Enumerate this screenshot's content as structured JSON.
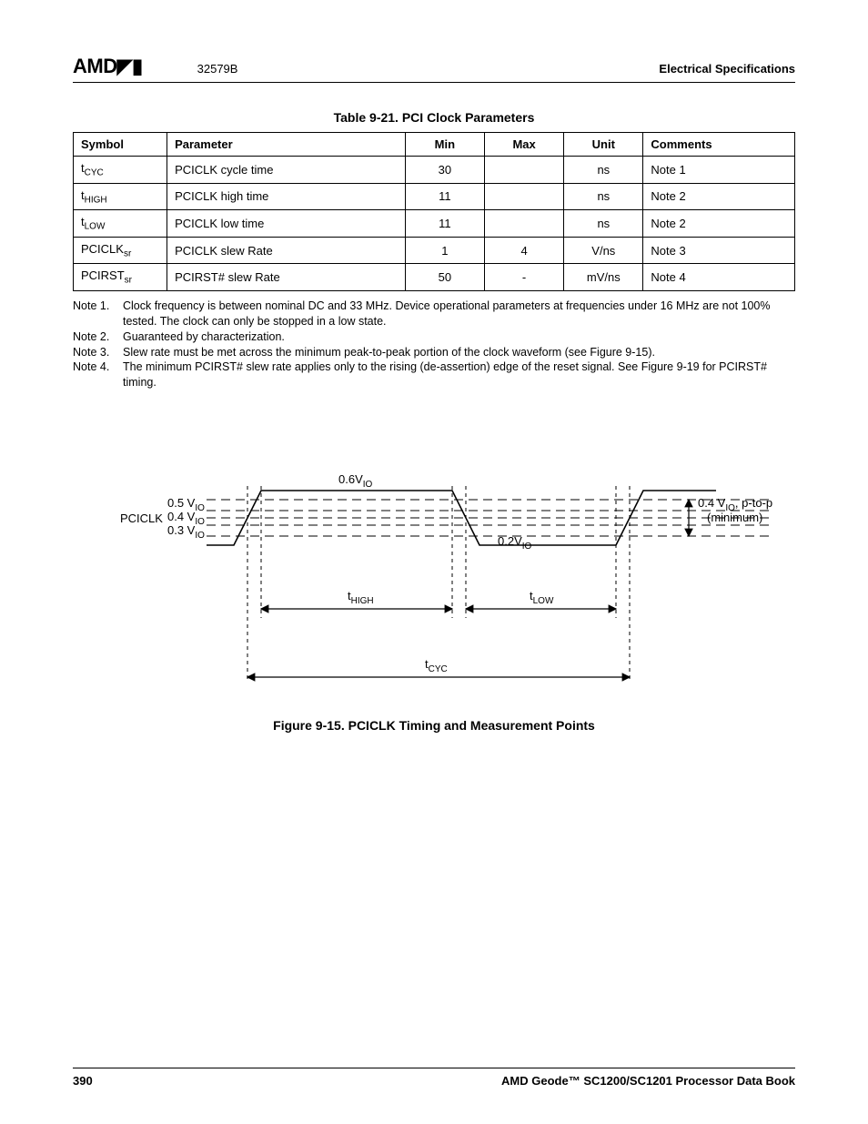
{
  "header": {
    "logo_text": "AMD",
    "doc_number": "32579B",
    "section": "Electrical Specifications"
  },
  "table": {
    "caption": "Table 9-21.  PCI Clock Parameters",
    "headers": {
      "symbol": "Symbol",
      "parameter": "Parameter",
      "min": "Min",
      "max": "Max",
      "unit": "Unit",
      "comments": "Comments"
    },
    "rows": [
      {
        "sym_main": "t",
        "sym_sub": "CYC",
        "param": "PCICLK cycle time",
        "min": "30",
        "max": "",
        "unit": "ns",
        "comments": "Note 1"
      },
      {
        "sym_main": "t",
        "sym_sub": "HIGH",
        "param": "PCICLK high time",
        "min": "11",
        "max": "",
        "unit": "ns",
        "comments": "Note 2"
      },
      {
        "sym_main": "t",
        "sym_sub": "LOW",
        "param": "PCICLK low time",
        "min": "11",
        "max": "",
        "unit": "ns",
        "comments": "Note 2"
      },
      {
        "sym_main": "PCICLK",
        "sym_sub": "sr",
        "param": "PCICLK slew Rate",
        "min": "1",
        "max": "4",
        "unit": "V/ns",
        "comments": "Note 3"
      },
      {
        "sym_main": "PCIRST",
        "sym_sub": "sr",
        "param": "PCIRST# slew Rate",
        "min": "50",
        "max": "-",
        "unit": "mV/ns",
        "comments": "Note 4"
      }
    ]
  },
  "notes": {
    "n1_label": "Note 1.",
    "n1_text": "Clock frequency is between nominal DC and 33 MHz. Device operational parameters at frequencies under 16 MHz are not 100% tested. The clock can only be stopped in a low state.",
    "n2_label": "Note 2.",
    "n2_text": "Guaranteed by characterization.",
    "n3_label": "Note 3.",
    "n3_text": "Slew rate must be met across the minimum peak-to-peak portion of the clock waveform (see Figure 9-15).",
    "n4_label": "Note 4.",
    "n4_text": "The minimum PCIRST# slew rate applies only to the rising (de-assertion) edge of the reset signal. See Figure 9-19 for PCIRST# timing."
  },
  "figure": {
    "caption": "Figure 9-15.  PCICLK Timing and Measurement Points",
    "labels": {
      "pciclk": "PCICLK",
      "v05": "0.5 V",
      "v04": "0.4 V",
      "v03": "0.3 V",
      "v06io": "0.6V",
      "v02io": "0.2V",
      "io_sub": "IO",
      "ptop_a": "0.4 V",
      "ptop_b": ", p-to-p",
      "ptop_c": "(minimum)",
      "thigh_main": "t",
      "thigh_sub": "HIGH",
      "tlow_main": "t",
      "tlow_sub": "LOW",
      "tcyc_main": "t",
      "tcyc_sub": "CYC"
    }
  },
  "footer": {
    "page_number": "390",
    "book_title": "AMD Geode™ SC1200/SC1201 Processor Data Book"
  }
}
